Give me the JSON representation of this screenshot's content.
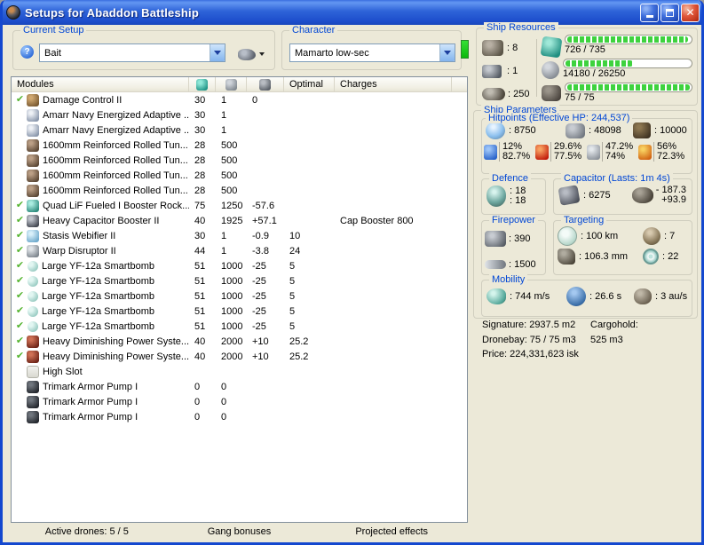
{
  "window": {
    "title": "Setups for Abaddon Battleship"
  },
  "current_setup": {
    "label": "Current Setup",
    "value": "Bait"
  },
  "character": {
    "label": "Character",
    "value": "Mamarto low-sec"
  },
  "ship_resources": {
    "label": "Ship Resources",
    "turrets": ": 8",
    "launchers": ": 1",
    "resource3": ": 250",
    "bars": [
      {
        "icon": "cpu",
        "text": "726 / 735",
        "fill_pct": 98.8
      },
      {
        "icon": "powergrid",
        "text": "14180 / 26250",
        "fill_pct": 54
      },
      {
        "icon": "calibration",
        "text": "75 / 75",
        "fill_pct": 100
      }
    ]
  },
  "modules": {
    "header": {
      "name": "Modules",
      "optimal": "Optimal",
      "charges": "Charges"
    },
    "rows": [
      {
        "fitted": true,
        "icon": "damage-control",
        "name": "Damage Control II",
        "cpu": "30",
        "pg": "1",
        "cap": "0",
        "optimal": "",
        "charges": ""
      },
      {
        "fitted": false,
        "icon": "energized-plating",
        "name": "Amarr Navy Energized Adaptive ...",
        "cpu": "30",
        "pg": "1",
        "cap": "",
        "optimal": "",
        "charges": ""
      },
      {
        "fitted": false,
        "icon": "energized-plating",
        "name": "Amarr Navy Energized Adaptive ...",
        "cpu": "30",
        "pg": "1",
        "cap": "",
        "optimal": "",
        "charges": ""
      },
      {
        "fitted": false,
        "icon": "armor-plate",
        "name": "1600mm Reinforced Rolled Tun...",
        "cpu": "28",
        "pg": "500",
        "cap": "",
        "optimal": "",
        "charges": ""
      },
      {
        "fitted": false,
        "icon": "armor-plate",
        "name": "1600mm Reinforced Rolled Tun...",
        "cpu": "28",
        "pg": "500",
        "cap": "",
        "optimal": "",
        "charges": ""
      },
      {
        "fitted": false,
        "icon": "armor-plate",
        "name": "1600mm Reinforced Rolled Tun...",
        "cpu": "28",
        "pg": "500",
        "cap": "",
        "optimal": "",
        "charges": ""
      },
      {
        "fitted": false,
        "icon": "armor-plate",
        "name": "1600mm Reinforced Rolled Tun...",
        "cpu": "28",
        "pg": "500",
        "cap": "",
        "optimal": "",
        "charges": ""
      },
      {
        "fitted": true,
        "icon": "propulsion",
        "name": "Quad LiF Fueled I Booster Rock...",
        "cpu": "75",
        "pg": "1250",
        "cap": "-57.6",
        "optimal": "",
        "charges": ""
      },
      {
        "fitted": true,
        "icon": "cap-booster",
        "name": "Heavy Capacitor Booster II",
        "cpu": "40",
        "pg": "1925",
        "cap": "+57.1",
        "optimal": "",
        "charges": "Cap Booster 800"
      },
      {
        "fitted": true,
        "icon": "stasis-webifier",
        "name": "Stasis Webifier II",
        "cpu": "30",
        "pg": "1",
        "cap": "-0.9",
        "optimal": "10",
        "charges": ""
      },
      {
        "fitted": true,
        "icon": "warp-disruptor",
        "name": "Warp Disruptor II",
        "cpu": "44",
        "pg": "1",
        "cap": "-3.8",
        "optimal": "24",
        "charges": ""
      },
      {
        "fitted": true,
        "icon": "smartbomb",
        "name": "Large YF-12a Smartbomb",
        "cpu": "51",
        "pg": "1000",
        "cap": "-25",
        "optimal": "5",
        "charges": ""
      },
      {
        "fitted": true,
        "icon": "smartbomb",
        "name": "Large YF-12a Smartbomb",
        "cpu": "51",
        "pg": "1000",
        "cap": "-25",
        "optimal": "5",
        "charges": ""
      },
      {
        "fitted": true,
        "icon": "smartbomb",
        "name": "Large YF-12a Smartbomb",
        "cpu": "51",
        "pg": "1000",
        "cap": "-25",
        "optimal": "5",
        "charges": ""
      },
      {
        "fitted": true,
        "icon": "smartbomb",
        "name": "Large YF-12a Smartbomb",
        "cpu": "51",
        "pg": "1000",
        "cap": "-25",
        "optimal": "5",
        "charges": ""
      },
      {
        "fitted": true,
        "icon": "smartbomb",
        "name": "Large YF-12a Smartbomb",
        "cpu": "51",
        "pg": "1000",
        "cap": "-25",
        "optimal": "5",
        "charges": ""
      },
      {
        "fitted": true,
        "icon": "energy-neutralizer",
        "name": "Heavy Diminishing Power Syste...",
        "cpu": "40",
        "pg": "2000",
        "cap": "+10",
        "optimal": "25.2",
        "charges": ""
      },
      {
        "fitted": true,
        "icon": "energy-neutralizer",
        "name": "Heavy Diminishing Power Syste...",
        "cpu": "40",
        "pg": "2000",
        "cap": "+10",
        "optimal": "25.2",
        "charges": ""
      },
      {
        "fitted": false,
        "icon": "empty-high-slot",
        "name": "High Slot",
        "cpu": "",
        "pg": "",
        "cap": "",
        "optimal": "",
        "charges": ""
      },
      {
        "fitted": false,
        "icon": "armor-rig",
        "name": "Trimark Armor Pump I",
        "cpu": "0",
        "pg": "0",
        "cap": "",
        "optimal": "",
        "charges": ""
      },
      {
        "fitted": false,
        "icon": "armor-rig",
        "name": "Trimark Armor Pump I",
        "cpu": "0",
        "pg": "0",
        "cap": "",
        "optimal": "",
        "charges": ""
      },
      {
        "fitted": false,
        "icon": "armor-rig",
        "name": "Trimark Armor Pump I",
        "cpu": "0",
        "pg": "0",
        "cap": "",
        "optimal": "",
        "charges": ""
      }
    ]
  },
  "tabs": {
    "active_drones": "Active drones: 5 / 5",
    "gang_bonuses": "Gang bonuses",
    "projected_effects": "Projected effects"
  },
  "ship_parameters": {
    "label": "Ship Parameters",
    "hitpoints": {
      "label": "Hitpoints (Effective HP: 244,537)",
      "shield": ": 8750",
      "armor": ": 48098",
      "structure": ": 10000",
      "resists": [
        {
          "icon": "em",
          "line1": "12%",
          "line2": "82.7%"
        },
        {
          "icon": "thermal",
          "line1": "29.6%",
          "line2": "77.5%"
        },
        {
          "icon": "kinetic",
          "line1": "47.2%",
          "line2": "74%"
        },
        {
          "icon": "explosive",
          "line1": "56%",
          "line2": "72.3%"
        }
      ]
    },
    "defence": {
      "label": "Defence",
      "value1": ": 18",
      "value2": ": 18"
    },
    "capacitor": {
      "label": "Capacitor (Lasts: 1m 4s)",
      "amount": ": 6275",
      "delta_out": "- 187.3",
      "delta_in": "+93.9"
    },
    "firepower": {
      "label": "Firepower",
      "volley": ": 390",
      "dps": ": 1500"
    },
    "targeting": {
      "label": "Targeting",
      "range": ": 100 km",
      "max_targets": ": 7",
      "scan_res": ": 106.3 mm",
      "sensor_strength": ": 22"
    },
    "mobility": {
      "label": "Mobility",
      "speed": ": 744 m/s",
      "align_time": ": 26.6 s",
      "warp_speed": ": 3 au/s"
    }
  },
  "stats": {
    "signature": "Signature: 2937.5 m2",
    "cargohold": "Cargohold: 525 m3",
    "dronebay": "Dronebay: 75 / 75 m3",
    "price": "Price: 224,331,623 isk"
  },
  "colors": {
    "label_blue": "#0046D5",
    "bar_green": "#3ED23E",
    "check_green": "#55B430"
  }
}
